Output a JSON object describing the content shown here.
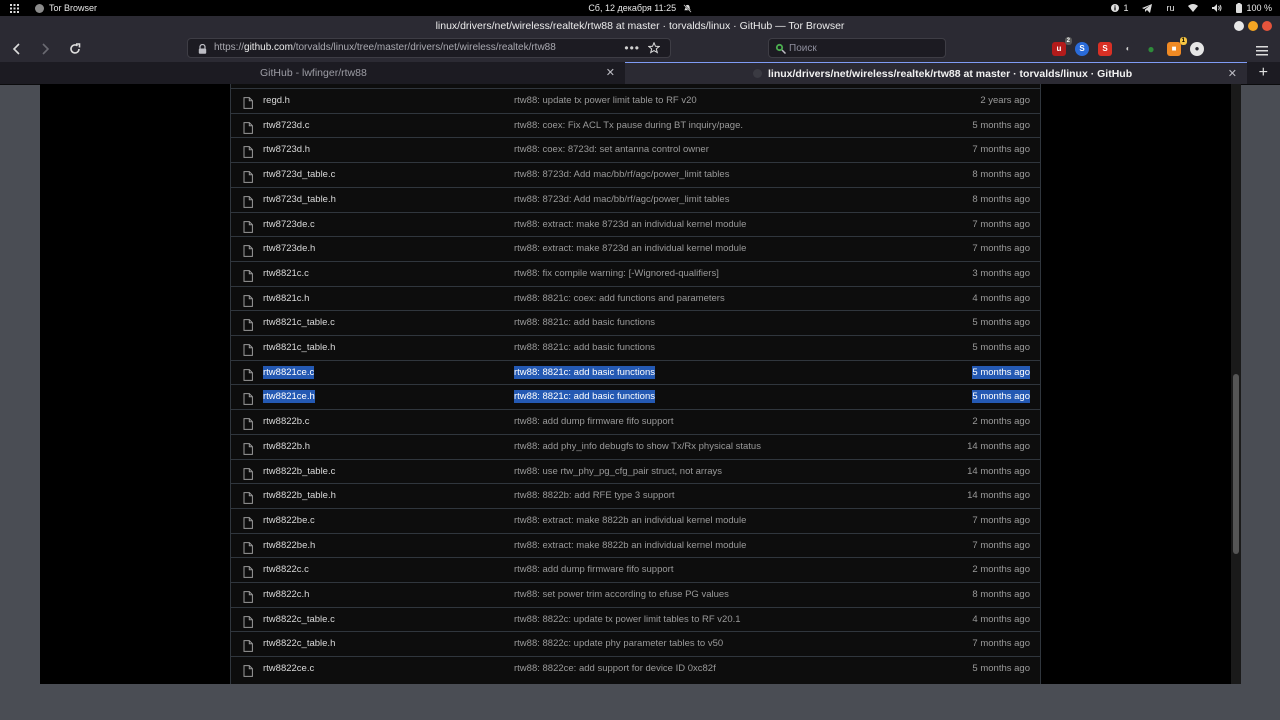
{
  "topbar": {
    "app_name": "Tor Browser",
    "clock": "Сб, 12 декабря  11:25",
    "indicators": {
      "count": "1",
      "lang": "ru",
      "battery": "100 %"
    }
  },
  "window": {
    "title": "linux/drivers/net/wireless/realtek/rtw88 at master · torvalds/linux · GitHub — Tor Browser",
    "controls": [
      "#e8e8e8",
      "#f5a623",
      "#e5543c"
    ]
  },
  "navbar": {
    "url_prefix": "https://",
    "url_host": "github.com",
    "url_path": "/torvalds/linux/tree/master/drivers/net/wireless/realtek/rtw88",
    "search_placeholder": "Поиск"
  },
  "extensions": [
    {
      "name": "ublock-icon",
      "color": "#b31b1b",
      "letter": "u",
      "badge": "2"
    },
    {
      "name": "s-circle-icon",
      "color": "#2a6bd8",
      "letter": "S",
      "badge": ""
    },
    {
      "name": "s-red-icon",
      "color": "#d93025",
      "letter": "S",
      "badge": ""
    },
    {
      "name": "spy-icon",
      "color": "#2b2a33",
      "letter": "◐",
      "badge": ""
    },
    {
      "name": "green-ext-icon",
      "color": "#2e8b3a",
      "letter": "●",
      "badge": ""
    },
    {
      "name": "orange-ext-icon",
      "color": "#f08a24",
      "letter": "■",
      "badge": "1"
    },
    {
      "name": "tor-circuit-icon",
      "color": "#e6e6e6",
      "letter": "●",
      "badge": ""
    }
  ],
  "tabs": [
    {
      "label": "GitHub - lwfinger/rtw88",
      "active": false
    },
    {
      "label": "linux/drivers/net/wireless/realtek/rtw88 at master · torvalds/linux · GitHub",
      "active": true
    }
  ],
  "files": [
    {
      "name": "regd.h",
      "msg": "rtw88: update tx power limit table to RF v20",
      "age": "2 years ago",
      "selected": false
    },
    {
      "name": "rtw8723d.c",
      "msg": "rtw88: coex: Fix ACL Tx pause during BT inquiry/page.",
      "age": "5 months ago",
      "selected": false
    },
    {
      "name": "rtw8723d.h",
      "msg": "rtw88: coex: 8723d: set antanna control owner",
      "age": "7 months ago",
      "selected": false
    },
    {
      "name": "rtw8723d_table.c",
      "msg": "rtw88: 8723d: Add mac/bb/rf/agc/power_limit tables",
      "age": "8 months ago",
      "selected": false
    },
    {
      "name": "rtw8723d_table.h",
      "msg": "rtw88: 8723d: Add mac/bb/rf/agc/power_limit tables",
      "age": "8 months ago",
      "selected": false
    },
    {
      "name": "rtw8723de.c",
      "msg": "rtw88: extract: make 8723d an individual kernel module",
      "age": "7 months ago",
      "selected": false
    },
    {
      "name": "rtw8723de.h",
      "msg": "rtw88: extract: make 8723d an individual kernel module",
      "age": "7 months ago",
      "selected": false
    },
    {
      "name": "rtw8821c.c",
      "msg": "rtw88: fix compile warning: [-Wignored-qualifiers]",
      "age": "3 months ago",
      "selected": false
    },
    {
      "name": "rtw8821c.h",
      "msg": "rtw88: 8821c: coex: add functions and parameters",
      "age": "4 months ago",
      "selected": false
    },
    {
      "name": "rtw8821c_table.c",
      "msg": "rtw88: 8821c: add basic functions",
      "age": "5 months ago",
      "selected": false
    },
    {
      "name": "rtw8821c_table.h",
      "msg": "rtw88: 8821c: add basic functions",
      "age": "5 months ago",
      "selected": false
    },
    {
      "name": "rtw8821ce.c",
      "msg": "rtw88: 8821c: add basic functions",
      "age": "5 months ago",
      "selected": true
    },
    {
      "name": "rtw8821ce.h",
      "msg": "rtw88: 8821c: add basic functions",
      "age": "5 months ago",
      "selected": true
    },
    {
      "name": "rtw8822b.c",
      "msg": "rtw88: add dump firmware fifo support",
      "age": "2 months ago",
      "selected": false
    },
    {
      "name": "rtw8822b.h",
      "msg": "rtw88: add phy_info debugfs to show Tx/Rx physical status",
      "age": "14 months ago",
      "selected": false
    },
    {
      "name": "rtw8822b_table.c",
      "msg": "rtw88: use rtw_phy_pg_cfg_pair struct, not arrays",
      "age": "14 months ago",
      "selected": false
    },
    {
      "name": "rtw8822b_table.h",
      "msg": "rtw88: 8822b: add RFE type 3 support",
      "age": "14 months ago",
      "selected": false
    },
    {
      "name": "rtw8822be.c",
      "msg": "rtw88: extract: make 8822b an individual kernel module",
      "age": "7 months ago",
      "selected": false
    },
    {
      "name": "rtw8822be.h",
      "msg": "rtw88: extract: make 8822b an individual kernel module",
      "age": "7 months ago",
      "selected": false
    },
    {
      "name": "rtw8822c.c",
      "msg": "rtw88: add dump firmware fifo support",
      "age": "2 months ago",
      "selected": false
    },
    {
      "name": "rtw8822c.h",
      "msg": "rtw88: set power trim according to efuse PG values",
      "age": "8 months ago",
      "selected": false
    },
    {
      "name": "rtw8822c_table.c",
      "msg": "rtw88: 8822c: update tx power limit tables to RF v20.1",
      "age": "4 months ago",
      "selected": false
    },
    {
      "name": "rtw8822c_table.h",
      "msg": "rtw88: 8822c: update phy parameter tables to v50",
      "age": "7 months ago",
      "selected": false
    },
    {
      "name": "rtw8822ce.c",
      "msg": "rtw88: 8822ce: add support for device ID 0xc82f",
      "age": "5 months ago",
      "selected": false
    }
  ]
}
